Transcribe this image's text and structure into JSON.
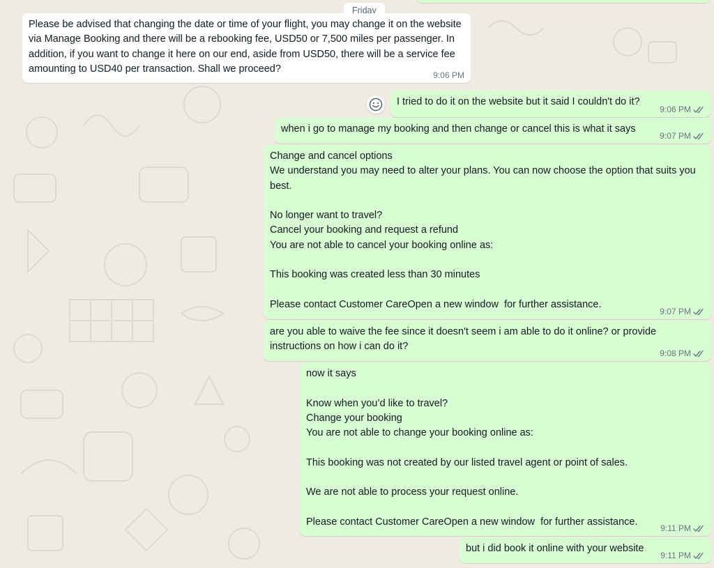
{
  "day_divider": "Friday",
  "messages": [
    {
      "direction": "in",
      "text": "Please be advised that changing the date or time of your flight, you may change it on the website via Manage Booking and there will be a rebooking fee, USD50 or 7,500 miles per passenger. In addition, if you want to change it here on our end, aside from USD50, there will be a service fee amounting to USD40 per transaction. Shall we proceed?",
      "time": "9:06 PM"
    },
    {
      "direction": "out",
      "text": "I tried to do it on the website but it said I couldn't do it?",
      "time": "9:06 PM",
      "status": "read"
    },
    {
      "direction": "out",
      "text": "when i go to manage my booking and then change or cancel this is what it says",
      "time": "9:07 PM",
      "status": "read"
    },
    {
      "direction": "out",
      "text": "Change and cancel options\nWe understand you may need to alter your plans. You can now choose the option that suits you best.\n\nNo longer want to travel?\nCancel your booking and request a refund\nYou are not able to cancel your booking online as:\n\nThis booking was created less than 30 minutes\n\nPlease contact Customer CareOpen a new window  for further assistance.",
      "time": "9:07 PM",
      "status": "read"
    },
    {
      "direction": "out",
      "text": "are you able to waive the fee since it doesn't seem i am able to do it online? or provide instructions on how i can do it?",
      "time": "9:08 PM",
      "status": "read"
    },
    {
      "direction": "out",
      "text": "now it says\n\nKnow when you’d like to travel?\nChange your booking\nYou are not able to change your booking online as:\n\nThis booking was not created by our listed travel agent or point of sales.\n\nWe are not able to process your request online.\n\nPlease contact Customer CareOpen a new window  for further assistance.",
      "time": "9:11 PM",
      "status": "read"
    },
    {
      "direction": "out",
      "text": "but i did book it online with your website",
      "time": "9:11 PM",
      "status": "read"
    }
  ],
  "icons": {
    "emoji_reaction": "smiley-face-icon",
    "read_receipt": "double-check-icon"
  },
  "colors": {
    "background": "#efeae2",
    "incoming_bubble": "#ffffff",
    "outgoing_bubble": "#d9fdd3",
    "read_ticks": "#667781",
    "timestamp": "#667781"
  }
}
